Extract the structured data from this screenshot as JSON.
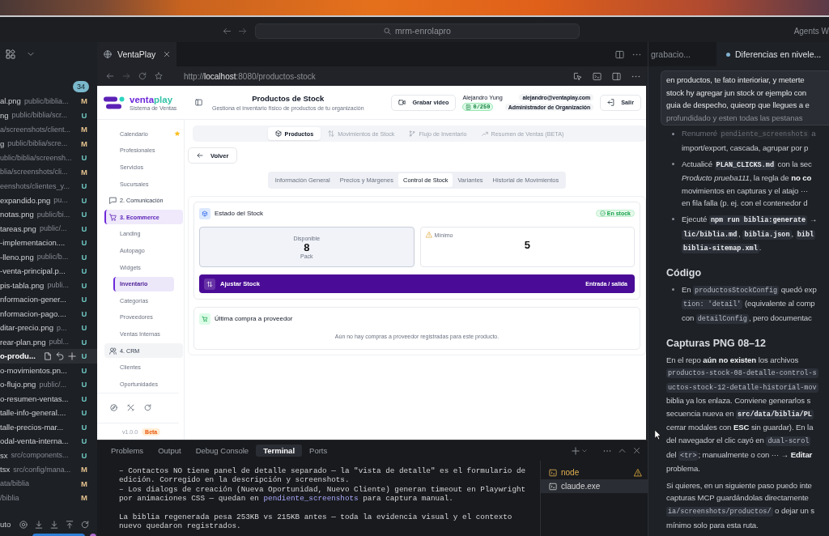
{
  "titlebar": {
    "command_center": "mrm-enrolapro",
    "agents": "Agents W"
  },
  "explorer": {
    "badge": "34",
    "files": [
      {
        "name": "al.png",
        "path": "public/biblia...",
        "status": "M",
        "color": "#e2c08d",
        "hovered": false
      },
      {
        "name": "ng",
        "path": "public/biblia/scr...",
        "status": "U",
        "color": "#6cc3bd",
        "hovered": false
      },
      {
        "path": "a/screenshots/client...",
        "status": "M",
        "color": "#e2c08d",
        "hovered": false
      },
      {
        "name": "g",
        "path": "public/biblia/scre...",
        "status": "M",
        "color": "#e2c08d",
        "hovered": false
      },
      {
        "path": "ublic/biblia/screensh...",
        "status": "U",
        "color": "#6cc3bd",
        "hovered": false
      },
      {
        "path": "blia/screenshots/cli...",
        "status": "M",
        "color": "#e2c08d",
        "hovered": false
      },
      {
        "path": "eenshots/clientes_y...",
        "status": "U",
        "color": "#6cc3bd",
        "hovered": false
      },
      {
        "name": "expandido.png",
        "path": "pu...",
        "status": "U",
        "color": "#6cc3bd",
        "hovered": false
      },
      {
        "name": "notas.png",
        "path": "public/bi...",
        "status": "U",
        "color": "#6cc3bd",
        "hovered": false
      },
      {
        "name": "tareas.png",
        "path": "public/...",
        "status": "U",
        "color": "#6cc3bd",
        "hovered": false
      },
      {
        "name": "-implementacion....",
        "status": "U",
        "color": "#6cc3bd",
        "hovered": false
      },
      {
        "name": "-lleno.png",
        "path": "public/b...",
        "status": "U",
        "color": "#6cc3bd",
        "hovered": false
      },
      {
        "name": "-venta-principal.p...",
        "status": "U",
        "color": "#6cc3bd",
        "hovered": false
      },
      {
        "name": "pis-tabla.png",
        "path": "publi...",
        "status": "U",
        "color": "#6cc3bd",
        "hovered": false
      },
      {
        "name": "nformacion-gener...",
        "status": "U",
        "color": "#6cc3bd",
        "hovered": false
      },
      {
        "name": "nformacion-pago....",
        "status": "U",
        "color": "#6cc3bd",
        "hovered": false
      },
      {
        "name": "ditar-precio.png",
        "path": "p...",
        "status": "U",
        "color": "#6cc3bd",
        "hovered": false
      },
      {
        "name": "rear-plan.png",
        "path": "publ...",
        "status": "U",
        "color": "#6cc3bd",
        "hovered": false
      },
      {
        "name": "o-produ...",
        "status": "U",
        "color": "#6cc3bd",
        "hovered": true
      },
      {
        "name": "o-movimientos.pn...",
        "status": "U",
        "color": "#6cc3bd",
        "hovered": false
      },
      {
        "name": "o-flujo.png",
        "path": "public/...",
        "status": "U",
        "color": "#6cc3bd",
        "hovered": false
      },
      {
        "name": "o-resumen-ventas...",
        "status": "U",
        "color": "#6cc3bd",
        "hovered": false
      },
      {
        "name": "talle-info-general....",
        "status": "U",
        "color": "#6cc3bd",
        "hovered": false
      },
      {
        "name": "talle-precios-mar...",
        "status": "U",
        "color": "#6cc3bd",
        "hovered": false
      },
      {
        "name": "odal-venta-interna...",
        "status": "U",
        "color": "#6cc3bd",
        "hovered": false
      },
      {
        "name": "sx",
        "path": "src/components...",
        "status": "U",
        "color": "#6cc3bd",
        "hovered": false
      },
      {
        "name": "tsx",
        "path": "src/config/mana...",
        "status": "M",
        "color": "#e2c08d",
        "hovered": false
      },
      {
        "path": "ata/biblia",
        "status": "M",
        "color": "#e2c08d",
        "hovered": false
      },
      {
        "path": "/biblia",
        "status": "M",
        "color": "#e2c08d",
        "hovered": false
      }
    ],
    "status_label": "uto"
  },
  "browser": {
    "tab_title": "VentaPlay",
    "url": "http://**localhost**:8080/productos-stock",
    "page": {
      "logo": {
        "name_parts": [
          {
            "text": "venta",
            "color": "#6d28d9"
          },
          {
            "text": "play",
            "color": "#34c3a7"
          }
        ],
        "tagline": "Sistema de Ventas"
      },
      "header": {
        "title": "Productos de Stock",
        "subtitle": "Gestiona el inventario físico de productos de tu organización",
        "record_button": "Grabar video",
        "user_name": "Alejandro Yung",
        "user_email": "alejandro@ventaplay.com",
        "quota": "0/250",
        "role": "Administrador de Organización",
        "logout_button": "Salir"
      },
      "sidebar": {
        "groups": [
          {
            "children": [
              {
                "label": "Calendario",
                "selected": false,
                "starred": true
              },
              {
                "label": "Profesionales",
                "selected": false,
                "starred": false
              },
              {
                "label": "Servicios",
                "selected": false,
                "starred": false
              },
              {
                "label": "Sucursales",
                "selected": false,
                "starred": false
              }
            ]
          },
          {
            "label": "2. Comunicación",
            "selected": false,
            "highlighted": false
          },
          {
            "label": "3. Ecommerce",
            "selected": true,
            "highlighted": false,
            "children": [
              {
                "label": "Landing",
                "selected": false,
                "starred": false
              },
              {
                "label": "Autopago",
                "selected": false,
                "starred": false
              },
              {
                "label": "Widgets",
                "selected": false,
                "starred": false
              },
              {
                "label": "Inventario",
                "selected": true,
                "starred": false
              },
              {
                "label": "Categorías",
                "selected": false,
                "starred": false
              },
              {
                "label": "Proveedores",
                "selected": false,
                "starred": false
              },
              {
                "label": "Ventas Internas",
                "selected": false,
                "starred": false
              }
            ]
          },
          {
            "label": "4. CRM",
            "selected": false,
            "highlighted": true,
            "children": [
              {
                "label": "Clientes",
                "selected": false,
                "starred": false
              },
              {
                "label": "Oportunidades",
                "selected": false,
                "starred": false
              }
            ]
          }
        ],
        "version": "v1.0.0",
        "version_badge": "Beta"
      },
      "tabs": [
        {
          "label": "Productos",
          "selected": true
        },
        {
          "label": "Movimientos de Stock",
          "selected": false
        },
        {
          "label": "Flujo de Inventario",
          "selected": false
        },
        {
          "label": "Resumen de Ventas (BETA)",
          "selected": false
        }
      ],
      "back_button": "Volver",
      "subtabs": [
        {
          "label": "Información General",
          "selected": false
        },
        {
          "label": "Precios y Márgenes",
          "selected": false
        },
        {
          "label": "Control de Stock",
          "selected": true
        },
        {
          "label": "Variantes",
          "selected": false
        },
        {
          "label": "Historial de Movimientos",
          "selected": false
        }
      ],
      "stock_card": {
        "title": "Estado del Stock",
        "status": "En stock",
        "stats": [
          {
            "kind": "available",
            "label": "Disponible",
            "value": "8",
            "unit": "Pack"
          },
          {
            "kind": "minimum",
            "label": "Mínimo",
            "value": "5"
          }
        ],
        "adjust_button": "Ajustar Stock",
        "adjust_hint": "Entrada / salida"
      },
      "purchase_card": {
        "title": "Última compra a proveedor",
        "empty_message": "Aún no hay compras a proveedor registradas para este producto."
      }
    }
  },
  "terminal": {
    "tabs": [
      {
        "label": "Problems",
        "selected": false
      },
      {
        "label": "Output",
        "selected": false
      },
      {
        "label": "Debug Console",
        "selected": false
      },
      {
        "label": "Terminal",
        "selected": true
      },
      {
        "label": "Ports",
        "selected": false
      }
    ],
    "blocks": [
      {
        "kind": "bullet",
        "lines": [
          "– Contactos NO tiene panel de detalle separado — la \"vista de detalle\" es el formulario de",
          "edición. Corregido en la descripción y screenshots."
        ]
      },
      {
        "kind": "bullet",
        "lines": [
          "– Los dialogs de creación (Nueva Oportunidad, Nuevo Cliente) generan timeout en Playwright",
          [
            "por animaciones CSS — quedan en ",
            {
              "code": "pendiente_screenshots",
              "strong": false
            },
            " para captura manual."
          ]
        ]
      },
      {
        "kind": "paragraph",
        "lines": [
          "La biblia regenerada pesa 253KB vs 215KB antes — toda la evidencia visual y el contexto",
          "nuevo quedaron registrados."
        ]
      }
    ],
    "sessions": [
      {
        "name": "node",
        "selected": false,
        "warning": true
      },
      {
        "name": "claude.exe",
        "selected": true,
        "warning": false
      }
    ]
  },
  "chat": {
    "tabs": [
      {
        "label": "grabacio...",
        "selected": false,
        "modified": false
      },
      {
        "label": "Diferencias en nivele...",
        "selected": true,
        "modified": true
      }
    ],
    "user_message": {
      "lines": [
        "en productos, te fato interioriar, y meterte",
        "stock hy agregar jun stock or ejemplo con",
        "guia de despecho, quieorp que llegues a e"
      ],
      "faded_line": "profundidado y esten todas las pestanas"
    },
    "response": {
      "top_faded": true,
      "blocks": [
        {
          "kind": "bullets",
          "items": [
            {
              "lines": [
                [
                  "Renumeré ",
                  {
                    "code": "pendiente_screenshots",
                    "strong": false
                  },
                  " a"
                ],
                "import/export, cascada, agrupar por p"
              ]
            },
            {
              "lines": [
                [
                  "Actualicé ",
                  {
                    "code": "PLAN_CLICKS.md",
                    "strong": true
                  },
                  " con la sec"
                ],
                "*Producto prueba111*, la regla de **no co**",
                "movimientos en capturas y el atajo ···",
                "en fila falla (p. ej. con el contenedor d"
              ]
            },
            {
              "lines": [
                [
                  "Ejecuté ",
                  {
                    "code": "npm run biblia:generate",
                    "strong": true
                  },
                  " →"
                ],
                [
                  {
                    "code": "lic/biblia.md",
                    "strong": true
                  },
                  ", ",
                  {
                    "code": "biblia.json",
                    "strong": true
                  },
                  ", ",
                  {
                    "code": "bibl",
                    "strong": true
                  }
                ],
                [
                  {
                    "code": "biblia-sitemap.xml",
                    "strong": true
                  },
                  "."
                ]
              ]
            }
          ]
        },
        {
          "kind": "heading",
          "text": "Código"
        },
        {
          "kind": "bullets",
          "items": [
            {
              "lines": [
                [
                  "En ",
                  {
                    "code": "productosStockConfig",
                    "strong": false
                  },
                  " quedó exp"
                ],
                [
                  {
                    "code": "tion: 'detail'",
                    "strong": false
                  },
                  " (equivalente al comp"
                ],
                [
                  "con ",
                  {
                    "code": "detailConfig",
                    "strong": false
                  },
                  ", pero documentac"
                ]
              ]
            }
          ]
        },
        {
          "kind": "heading",
          "text": "Capturas PNG 08–12"
        },
        {
          "kind": "paragraph",
          "lines": [
            "En el repo **aún no existen** los archivos",
            [
              {
                "code": "productos-stock-08-detalle-control-s",
                "strong": false
              }
            ],
            [
              {
                "code": "uctos-stock-12-detalle-historial-mov",
                "strong": false
              }
            ],
            "biblia ya los enlaza. Conviene generarlos s",
            [
              "secuencia nueva en ",
              {
                "code": "src/data/biblia/PL",
                "strong": true
              }
            ],
            "cerrar modales con **ESC** sin guardar). En la",
            [
              "del navegador el clic cayó en ",
              {
                "code": "dual-scrol",
                "strong": false
              }
            ],
            [
              "del ",
              {
                "code": "<tr>",
                "strong": false
              },
              "; manualmente o con ··· → **Editar**"
            ],
            "problema."
          ]
        },
        {
          "kind": "paragraph",
          "lines": [
            "Si quieres, en un siguiente paso puedo inte",
            "capturas MCP guardándolas directamente",
            [
              {
                "code": "ia/screenshots/productos/",
                "strong": false
              },
              " o dejar un s"
            ],
            "mínimo solo para esta ruta."
          ]
        }
      ]
    }
  }
}
